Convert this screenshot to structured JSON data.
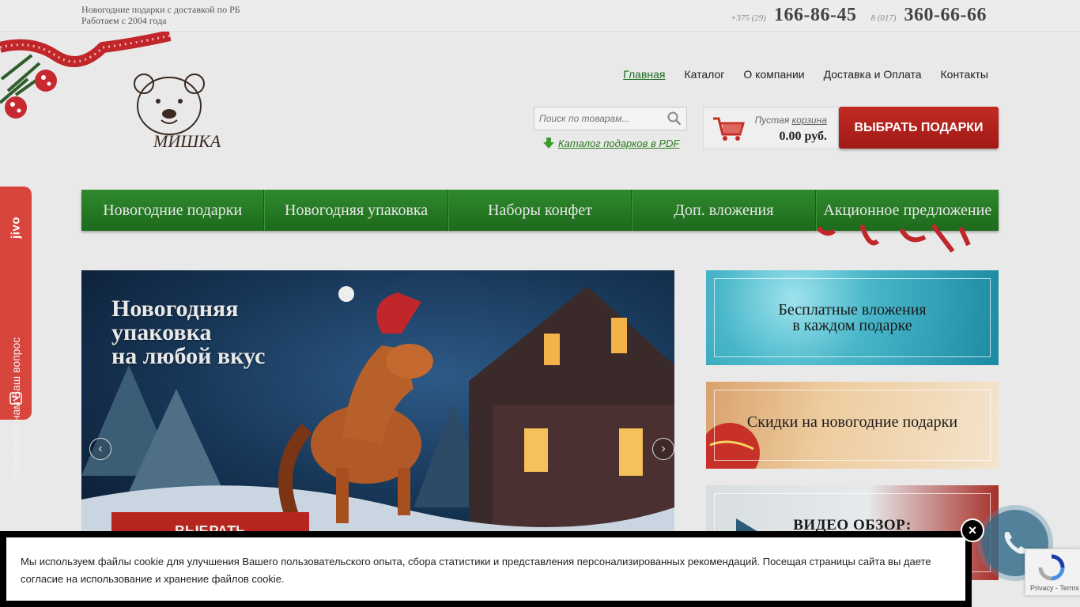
{
  "topbar": {
    "tagline_line1": "Новогодние подарки с доставкой по РБ",
    "tagline_line2": "Работаем с 2004 года",
    "phone1_code": "+375 (29)",
    "phone1_number": "166-86-45",
    "phone2_code": "8 (017)",
    "phone2_number": "360-66-66"
  },
  "logo": {
    "text": "МИШКА"
  },
  "mainnav": [
    {
      "label": "Главная",
      "active": true
    },
    {
      "label": "Каталог"
    },
    {
      "label": "О компании"
    },
    {
      "label": "Доставка и Оплата"
    },
    {
      "label": "Контакты"
    }
  ],
  "search": {
    "placeholder": "Поиск по товарам..."
  },
  "pdf_link": "Каталог подарков в PDF",
  "cart": {
    "status_prefix": "Пустая",
    "status_link": "корзина",
    "total": "0.00 руб."
  },
  "choose_button": "ВЫБРАТЬ ПОДАРКИ",
  "categories": [
    "Новогодние подарки",
    "Новогодняя упаковка",
    "Наборы конфет",
    "Доп. вложения",
    "Акционное предложение"
  ],
  "slider": {
    "caption_line1": "Новогодняя",
    "caption_line2": "упаковка",
    "caption_line3": "на любой вкус",
    "button": "ВЫБРАТЬ",
    "prev": "‹",
    "next": "›"
  },
  "promos": {
    "free_line1": "Бесплатные вложения",
    "free_line2": "в каждом подарке",
    "discounts": "Скидки на новогодние подарки",
    "video": "ВИДЕО ОБЗОР:"
  },
  "jivo": {
    "text": "Отправьте нам Ваш вопрос",
    "logo": "jivo"
  },
  "cookie": {
    "text": "Мы используем файлы cookie для улучшения Вашего пользовательского опыта, сбора статистики и представления персонализированных рекомендаций. Посещая страницы сайта вы даете согласие на использование и хранение файлов cookie.",
    "close": "×"
  },
  "recaptcha": {
    "terms": "Privacy - Terms"
  },
  "colors": {
    "green": "#1d6a1c",
    "red": "#b62520",
    "jivo": "#d8453d"
  }
}
